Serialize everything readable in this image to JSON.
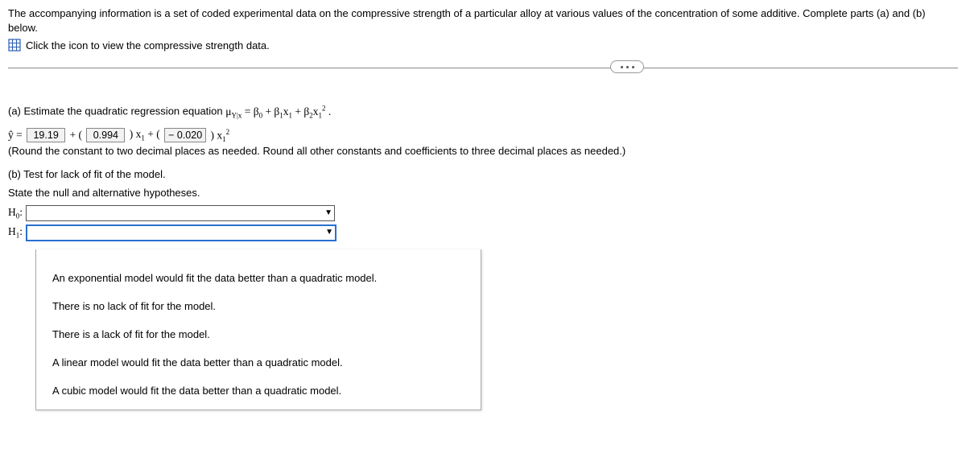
{
  "intro": "The accompanying information is a set of coded experimental data on the compressive strength of a particular alloy at various values of the concentration of some additive. Complete parts (a) and (b) below.",
  "icon_link": "Click the icon to view the compressive strength data.",
  "part_a": {
    "prompt_prefix": "(a) Estimate the quadratic regression equation ",
    "equation": {
      "b0": "19.19",
      "b1": "0.994",
      "b2": "− 0.020"
    },
    "round_note": "(Round the constant to two decimal places as needed. Round all other constants and coefficients to three decimal places as needed.)"
  },
  "part_b": {
    "prompt": "(b) Test for lack of fit of the model.",
    "state": "State the null and alternative hypotheses.",
    "h0_label": "H",
    "h1_label": "H"
  },
  "dropdown": {
    "options": [
      "An exponential model would fit the data better than a quadratic model.",
      "There is no lack of fit for the model.",
      "There is a lack of fit for the model.",
      "A linear model would fit the data better than a quadratic model.",
      "A cubic model would fit the data better than a quadratic model."
    ]
  }
}
